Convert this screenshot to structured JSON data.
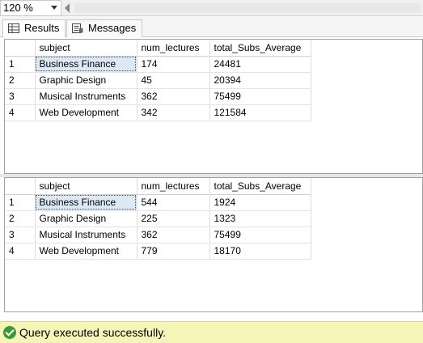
{
  "zoom": {
    "value": "120 %"
  },
  "tabs": [
    {
      "label": "Results",
      "icon": "grid-icon",
      "active": true
    },
    {
      "label": "Messages",
      "icon": "messages-icon",
      "active": false
    }
  ],
  "result_sets": [
    {
      "columns": [
        "subject",
        "num_lectures",
        "total_Subs_Average"
      ],
      "rows": [
        {
          "num": "1",
          "subject": "Business Finance",
          "num_lectures": "174",
          "total_Subs_Average": "24481"
        },
        {
          "num": "2",
          "subject": "Graphic Design",
          "num_lectures": "45",
          "total_Subs_Average": "20394"
        },
        {
          "num": "3",
          "subject": "Musical Instruments",
          "num_lectures": "362",
          "total_Subs_Average": "75499"
        },
        {
          "num": "4",
          "subject": "Web Development",
          "num_lectures": "342",
          "total_Subs_Average": "121584"
        }
      ]
    },
    {
      "columns": [
        "subject",
        "num_lectures",
        "total_Subs_Average"
      ],
      "rows": [
        {
          "num": "1",
          "subject": "Business Finance",
          "num_lectures": "544",
          "total_Subs_Average": "1924"
        },
        {
          "num": "2",
          "subject": "Graphic Design",
          "num_lectures": "225",
          "total_Subs_Average": "1323"
        },
        {
          "num": "3",
          "subject": "Musical Instruments",
          "num_lectures": "362",
          "total_Subs_Average": "75499"
        },
        {
          "num": "4",
          "subject": "Web Development",
          "num_lectures": "779",
          "total_Subs_Average": "18170"
        }
      ]
    }
  ],
  "status": {
    "text": "Query executed successfully.",
    "icon": "check-circle-icon",
    "color": "#3a9a3a",
    "background": "#f5f5b8"
  }
}
